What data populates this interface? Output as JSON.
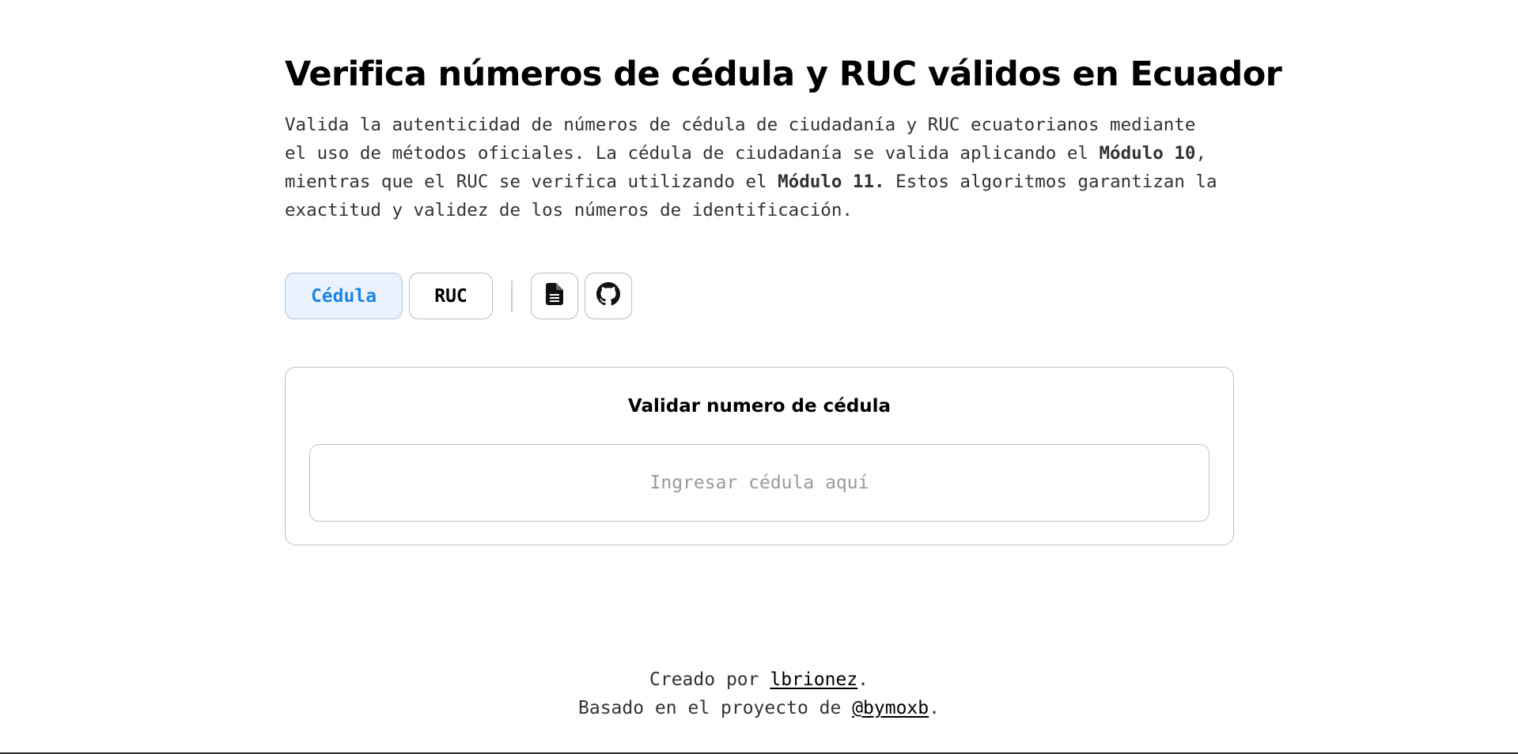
{
  "header": {
    "title": "Verifica números de cédula y RUC válidos en Ecuador",
    "description": {
      "part1": "Valida la autenticidad de números de cédula de ciudadanía y RUC ecuatorianos mediante el uso de métodos oficiales. La cédula de ciudadanía se valida aplicando el ",
      "bold1": "Módulo 10",
      "part2": ", mientras que el RUC se verifica utilizando el ",
      "bold2": "Módulo 11.",
      "part3": " Estos algoritmos garantizan la exactitud y validez de los números de identificación."
    }
  },
  "tabs": [
    {
      "label": "Cédula",
      "active": true
    },
    {
      "label": "RUC",
      "active": false
    }
  ],
  "toolbar_icons": [
    "document-icon",
    "github-icon"
  ],
  "card": {
    "title": "Validar numero de cédula",
    "input_placeholder": "Ingresar cédula aquí",
    "input_value": ""
  },
  "footer": {
    "line1_prefix": "Creado por ",
    "line1_link": "lbrionez",
    "line1_suffix": ".",
    "line2_prefix": "Basado en el proyecto de ",
    "line2_link": "@bymoxb",
    "line2_suffix": "."
  },
  "colors": {
    "accent": "#1f85e0",
    "active_tab_bg": "#eaf3fd",
    "border": "#c4c4c4",
    "text": "#333333"
  }
}
